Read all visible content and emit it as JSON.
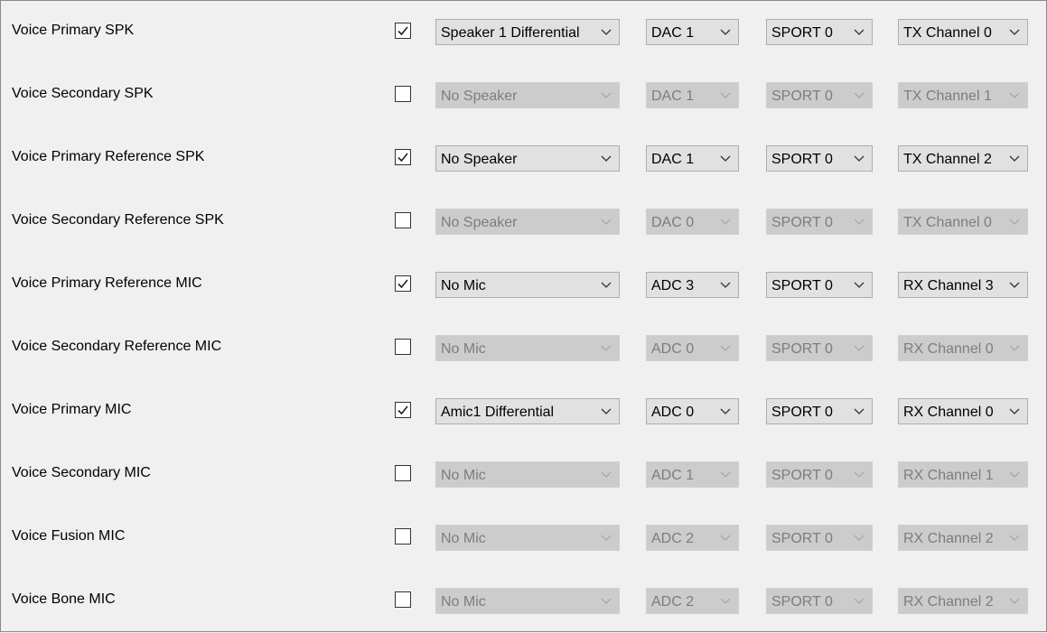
{
  "rows": [
    {
      "label": "Voice Primary SPK",
      "checked": true,
      "device": "Speaker 1 Differential",
      "converter": "DAC 1",
      "sport": "SPORT 0",
      "channel": "TX Channel 0"
    },
    {
      "label": "Voice Secondary SPK",
      "checked": false,
      "device": "No Speaker",
      "converter": "DAC 1",
      "sport": "SPORT 0",
      "channel": "TX Channel 1"
    },
    {
      "label": "Voice Primary Reference SPK",
      "checked": true,
      "device": "No Speaker",
      "converter": "DAC 1",
      "sport": "SPORT 0",
      "channel": "TX Channel 2"
    },
    {
      "label": "Voice Secondary Reference SPK",
      "checked": false,
      "device": "No Speaker",
      "converter": "DAC 0",
      "sport": "SPORT 0",
      "channel": "TX Channel 0"
    },
    {
      "label": "Voice Primary Reference MIC",
      "checked": true,
      "device": "No Mic",
      "converter": "ADC 3",
      "sport": "SPORT 0",
      "channel": "RX Channel 3"
    },
    {
      "label": "Voice Secondary Reference MIC",
      "checked": false,
      "device": "No Mic",
      "converter": "ADC 0",
      "sport": "SPORT 0",
      "channel": "RX Channel 0"
    },
    {
      "label": "Voice Primary MIC",
      "checked": true,
      "device": "Amic1 Differential",
      "converter": "ADC 0",
      "sport": "SPORT 0",
      "channel": "RX Channel 0"
    },
    {
      "label": "Voice Secondary MIC",
      "checked": false,
      "device": "No Mic",
      "converter": "ADC 1",
      "sport": "SPORT 0",
      "channel": "RX Channel 1"
    },
    {
      "label": "Voice Fusion MIC",
      "checked": false,
      "device": "No Mic",
      "converter": "ADC 2",
      "sport": "SPORT 0",
      "channel": "RX Channel 2"
    },
    {
      "label": "Voice Bone MIC",
      "checked": false,
      "device": "No Mic",
      "converter": "ADC 2",
      "sport": "SPORT 0",
      "channel": "RX Channel 2"
    }
  ],
  "icons": {
    "checkbox_mark": "checkmark-icon",
    "dropdown_arrow": "chevron-down-icon"
  }
}
